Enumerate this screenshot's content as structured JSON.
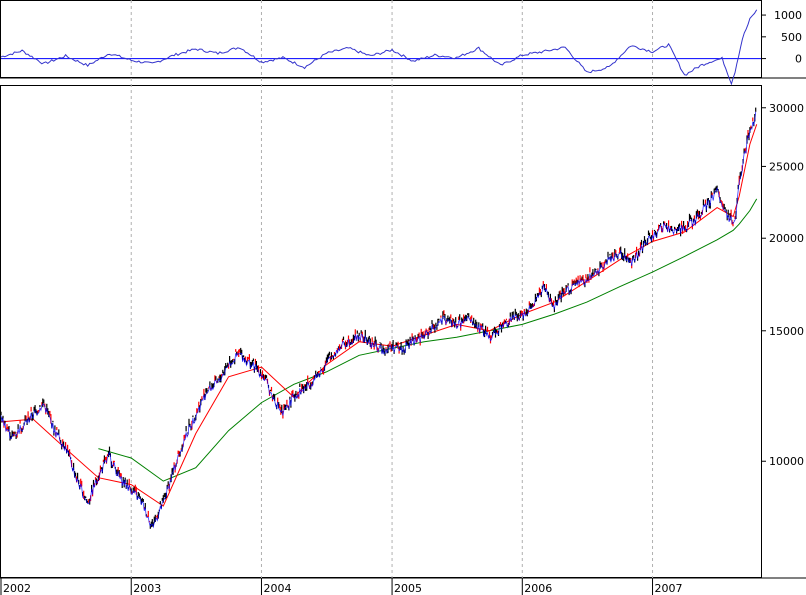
{
  "chart_data": [
    {
      "type": "line",
      "panel": "oscillator",
      "title": "",
      "xlabel": "",
      "ylabel": "",
      "ylim": [
        -400,
        1300
      ],
      "yticks": [
        1000,
        500,
        0
      ],
      "grid": true,
      "colors": {
        "oscillator": "#3333cc",
        "zero_line": "#0000ff"
      },
      "series": [
        {
          "x": [
            "2002-01-01",
            "2002-03-01",
            "2002-05-01",
            "2002-07-01",
            "2002-09-01",
            "2002-11-01",
            "2003-01-01",
            "2003-03-01",
            "2003-05-01",
            "2003-07-01",
            "2003-09-01",
            "2003-11-01",
            "2004-01-01",
            "2004-03-01",
            "2004-05-01",
            "2004-07-01",
            "2004-09-01",
            "2004-11-01",
            "2005-01-01",
            "2005-03-01",
            "2005-05-01",
            "2005-07-01",
            "2005-09-01",
            "2005-11-01",
            "2006-01-01",
            "2006-03-01",
            "2006-05-01",
            "2006-07-01",
            "2006-09-01",
            "2006-11-01",
            "2007-01-01",
            "2007-02-15",
            "2007-04-01",
            "2007-05-15",
            "2007-06-15",
            "2007-07-15",
            "2007-08-10",
            "2007-08-20",
            "2007-09-10",
            "2007-10-01",
            "2007-10-20"
          ],
          "values": [
            40,
            180,
            -120,
            60,
            -160,
            120,
            -40,
            -120,
            80,
            220,
            120,
            260,
            -80,
            20,
            -200,
            120,
            240,
            60,
            200,
            -60,
            80,
            20,
            240,
            -160,
            80,
            160,
            260,
            -320,
            -200,
            300,
            160,
            320,
            -380,
            -160,
            -60,
            0,
            -560,
            -300,
            460,
            900,
            1120
          ]
        }
      ]
    },
    {
      "type": "line",
      "panel": "price",
      "title": "",
      "xlabel": "",
      "ylabel": "",
      "scale": "log",
      "ylim": [
        7000,
        32000
      ],
      "yticks": [
        30000,
        25000,
        20000,
        15000,
        10000
      ],
      "x_tick_labels": [
        "2002",
        "2003",
        "2004",
        "2005",
        "2006",
        "2007"
      ],
      "grid": true,
      "colors": {
        "price": "#000000",
        "ma_short": "#ff0000",
        "ma_medium": "#0000ff",
        "ma_long": "#008000",
        "down_bar": "#ff0000"
      },
      "series": [
        {
          "x": [
            "2002-01-01",
            "2002-02-01",
            "2002-03-01",
            "2002-04-01",
            "2002-05-01",
            "2002-06-01",
            "2002-07-01",
            "2002-08-01",
            "2002-09-01",
            "2002-10-01",
            "2002-11-01",
            "2002-12-01",
            "2003-01-01",
            "2003-02-01",
            "2003-03-01",
            "2003-04-01",
            "2003-05-01",
            "2003-06-01",
            "2003-07-01",
            "2003-08-01",
            "2003-09-01",
            "2003-10-01",
            "2003-11-01",
            "2003-12-01",
            "2004-01-01",
            "2004-02-01",
            "2004-03-01",
            "2004-04-01",
            "2004-05-01",
            "2004-06-01",
            "2004-07-01",
            "2004-08-01",
            "2004-09-01",
            "2004-10-01",
            "2004-11-01",
            "2004-12-01",
            "2005-01-01",
            "2005-02-01",
            "2005-03-01",
            "2005-04-01",
            "2005-05-01",
            "2005-06-01",
            "2005-07-01",
            "2005-08-01",
            "2005-09-01",
            "2005-10-01",
            "2005-11-01",
            "2005-12-01",
            "2006-01-01",
            "2006-02-01",
            "2006-03-01",
            "2006-04-01",
            "2006-05-01",
            "2006-06-01",
            "2006-07-01",
            "2006-08-01",
            "2006-09-01",
            "2006-10-01",
            "2006-11-01",
            "2006-12-01",
            "2007-01-01",
            "2007-02-01",
            "2007-03-01",
            "2007-04-01",
            "2007-05-01",
            "2007-06-01",
            "2007-07-01",
            "2007-08-01",
            "2007-08-20",
            "2007-09-01",
            "2007-10-01",
            "2007-10-20"
          ],
          "values": [
            11500,
            10800,
            11200,
            11600,
            12000,
            11000,
            10500,
            9500,
            8800,
            9600,
            10200,
            9500,
            9200,
            8800,
            8200,
            8800,
            9800,
            10800,
            11600,
            12500,
            12800,
            13600,
            14000,
            13600,
            13200,
            12300,
            11600,
            12300,
            12600,
            13000,
            13600,
            14200,
            14600,
            14800,
            14500,
            14200,
            14300,
            14200,
            14600,
            14800,
            15300,
            15600,
            15300,
            15600,
            15200,
            14800,
            15200,
            15600,
            15800,
            16400,
            17200,
            16200,
            17000,
            17400,
            17600,
            18200,
            18800,
            19200,
            18600,
            19500,
            20200,
            20800,
            20500,
            20800,
            21200,
            22200,
            23200,
            21500,
            21000,
            24000,
            28000,
            29800
          ]
        },
        {
          "x": [
            "2002-01-01",
            "2002-04-01",
            "2002-07-01",
            "2002-10-01",
            "2003-01-01",
            "2003-04-01",
            "2003-07-01",
            "2003-10-01",
            "2004-01-01",
            "2004-04-01",
            "2004-07-01",
            "2004-10-01",
            "2005-01-01",
            "2005-04-01",
            "2005-07-01",
            "2005-10-01",
            "2006-01-01",
            "2006-04-01",
            "2006-07-01",
            "2006-10-01",
            "2007-01-01",
            "2007-04-01",
            "2007-07-01",
            "2007-08-15",
            "2007-09-01",
            "2007-10-01",
            "2007-10-20"
          ],
          "values": [
            11300,
            11400,
            10400,
            9500,
            9300,
            8700,
            10900,
            13000,
            13400,
            12200,
            13500,
            14500,
            14300,
            14800,
            15300,
            15000,
            15800,
            16400,
            17500,
            18700,
            19800,
            20400,
            22000,
            21400,
            22800,
            26800,
            28500
          ]
        },
        {
          "x": [
            "2002-10-01",
            "2003-01-01",
            "2003-04-01",
            "2003-07-01",
            "2003-10-01",
            "2004-01-01",
            "2004-04-01",
            "2004-07-01",
            "2004-10-01",
            "2005-01-01",
            "2005-04-01",
            "2005-07-01",
            "2005-10-01",
            "2006-01-01",
            "2006-04-01",
            "2006-07-01",
            "2006-10-01",
            "2007-01-01",
            "2007-04-01",
            "2007-07-01",
            "2007-08-15",
            "2007-09-01",
            "2007-10-01",
            "2007-10-20"
          ],
          "values": [
            10400,
            10100,
            9400,
            9800,
            11000,
            12000,
            12700,
            13200,
            13900,
            14200,
            14500,
            14700,
            15000,
            15300,
            15800,
            16400,
            17200,
            18000,
            18900,
            19900,
            20500,
            20900,
            21800,
            22600
          ]
        }
      ]
    }
  ]
}
